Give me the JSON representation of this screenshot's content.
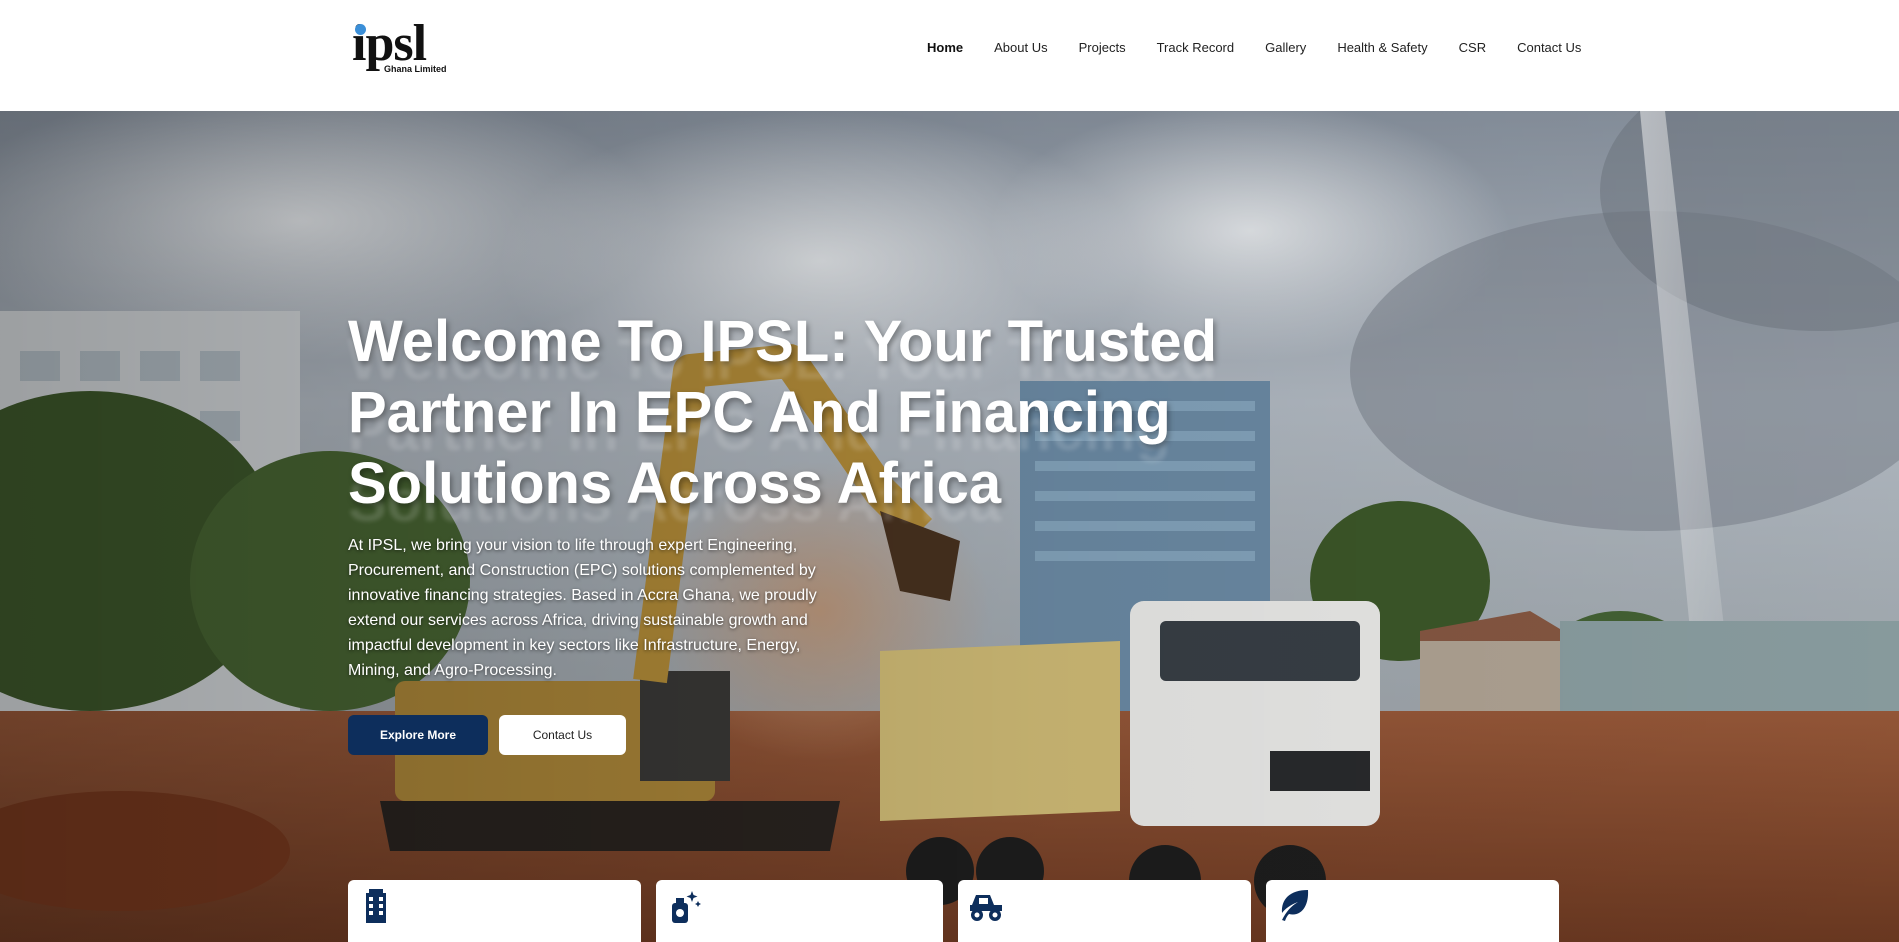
{
  "brand": {
    "logo_text": "ipsl",
    "logo_subtitle": "Ghana Limited",
    "accent_color": "#0d2e5c",
    "logo_dot_color": "#3b8fd8"
  },
  "nav": {
    "items": [
      {
        "label": "Home",
        "active": true
      },
      {
        "label": "About Us"
      },
      {
        "label": "Projects"
      },
      {
        "label": "Track Record"
      },
      {
        "label": "Gallery"
      },
      {
        "label": "Health & Safety"
      },
      {
        "label": "CSR"
      },
      {
        "label": "Contact Us"
      }
    ]
  },
  "hero": {
    "title": "Welcome To IPSL: Your Trusted Partner In EPC And Financing Solutions Across Africa",
    "description": "At IPSL, we bring your vision to life through expert Engineering, Procurement, and Construction (EPC) solutions complemented by innovative financing strategies. Based in Accra  Ghana, we proudly extend our services across Africa, driving sustainable growth and impactful development in key sectors like Infrastructure, Energy, Mining, and Agro-Processing.",
    "primary_button": "Explore More",
    "secondary_button": "Contact Us",
    "image_subject": "construction site with excavator and SHACMAN dump truck"
  },
  "cards": [
    {
      "icon": "building-icon"
    },
    {
      "icon": "sparkle-spray-icon"
    },
    {
      "icon": "tractor-icon"
    },
    {
      "icon": "leaf-icon"
    }
  ]
}
